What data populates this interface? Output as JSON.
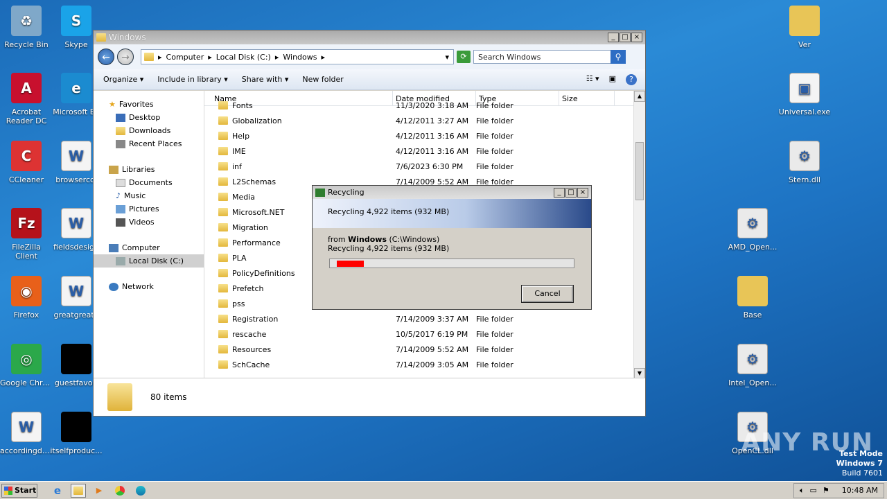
{
  "desktop": {
    "icons_left": [
      {
        "label": "Recycle Bin",
        "icon": "recycle-bin-icon"
      },
      {
        "label": "Skype",
        "icon": "skype-icon"
      },
      {
        "label": "Acrobat Reader DC",
        "icon": "acrobat-icon"
      },
      {
        "label": "Microsoft Ed",
        "icon": "edge-icon"
      },
      {
        "label": "CCleaner",
        "icon": "ccleaner-icon"
      },
      {
        "label": "browsercol",
        "icon": "word-doc-icon"
      },
      {
        "label": "FileZilla Client",
        "icon": "filezilla-icon"
      },
      {
        "label": "fieldsdesign",
        "icon": "word-doc-icon"
      },
      {
        "label": "Firefox",
        "icon": "firefox-icon"
      },
      {
        "label": "greatgreate",
        "icon": "word-doc-icon"
      },
      {
        "label": "Google Chrome",
        "icon": "chrome-icon"
      },
      {
        "label": "guestfavori",
        "icon": "black-file-icon"
      },
      {
        "label": "accordingd.rtf",
        "icon": "word-doc-icon"
      },
      {
        "label": "itselfproduc...",
        "icon": "black-file-icon"
      }
    ],
    "icons_right": [
      {
        "label": "Ver",
        "icon": "folder-icon"
      },
      {
        "label": "Universal.exe",
        "icon": "exe-icon"
      },
      {
        "label": "Stern.dll",
        "icon": "dll-icon"
      },
      {
        "label": "AMD_Open...",
        "icon": "dll-icon"
      },
      {
        "label": "Base",
        "icon": "folder-icon"
      },
      {
        "label": "Intel_Open...",
        "icon": "dll-icon"
      },
      {
        "label": "OpenCL.dll",
        "icon": "dll-icon"
      }
    ],
    "watermark": "ANY RUN",
    "test_mode": {
      "line1": "Test Mode",
      "line2": "Windows 7",
      "line3": "Build 7601"
    }
  },
  "explorer": {
    "title": "Windows",
    "address": {
      "part1": "Computer",
      "part2": "Local Disk (C:)",
      "part3": "Windows"
    },
    "search_placeholder": "Search Windows",
    "toolbar": {
      "organize": "Organize",
      "include": "Include in library",
      "share": "Share with",
      "newfolder": "New folder"
    },
    "nav": {
      "favorites": "Favorites",
      "desktop": "Desktop",
      "downloads": "Downloads",
      "recent": "Recent Places",
      "libraries": "Libraries",
      "documents": "Documents",
      "music": "Music",
      "pictures": "Pictures",
      "videos": "Videos",
      "computer": "Computer",
      "localdisk": "Local Disk (C:)",
      "network": "Network"
    },
    "columns": {
      "name": "Name",
      "date": "Date modified",
      "type": "Type",
      "size": "Size"
    },
    "rows": [
      {
        "name": "Fonts",
        "date": "11/3/2020 3:18 AM",
        "type": "File folder"
      },
      {
        "name": "Globalization",
        "date": "4/12/2011 3:27 AM",
        "type": "File folder"
      },
      {
        "name": "Help",
        "date": "4/12/2011 3:16 AM",
        "type": "File folder"
      },
      {
        "name": "IME",
        "date": "4/12/2011 3:16 AM",
        "type": "File folder"
      },
      {
        "name": "inf",
        "date": "7/6/2023 6:30 PM",
        "type": "File folder"
      },
      {
        "name": "L2Schemas",
        "date": "7/14/2009 5:52 AM",
        "type": "File folder"
      },
      {
        "name": "Media",
        "date": "",
        "type": ""
      },
      {
        "name": "Microsoft.NET",
        "date": "",
        "type": ""
      },
      {
        "name": "Migration",
        "date": "",
        "type": ""
      },
      {
        "name": "Performance",
        "date": "",
        "type": ""
      },
      {
        "name": "PLA",
        "date": "",
        "type": ""
      },
      {
        "name": "PolicyDefinitions",
        "date": "",
        "type": ""
      },
      {
        "name": "Prefetch",
        "date": "",
        "type": ""
      },
      {
        "name": "pss",
        "date": "",
        "type": ""
      },
      {
        "name": "Registration",
        "date": "7/14/2009 3:37 AM",
        "type": "File folder"
      },
      {
        "name": "rescache",
        "date": "10/5/2017 6:19 PM",
        "type": "File folder"
      },
      {
        "name": "Resources",
        "date": "7/14/2009 5:52 AM",
        "type": "File folder"
      },
      {
        "name": "SchCache",
        "date": "7/14/2009 3:05 AM",
        "type": "File folder"
      }
    ],
    "status": "80 items"
  },
  "dialog": {
    "title": "Recycling",
    "heading": "Recycling 4,922 items (932 MB)",
    "from_prefix": "from ",
    "from_bold": "Windows",
    "from_path": " (C:\\Windows)",
    "detail": "Recycling 4,922 items (932 MB)",
    "progress": 0.11,
    "cancel": "Cancel"
  },
  "taskbar": {
    "start": "Start",
    "clock": "10:48 AM"
  }
}
